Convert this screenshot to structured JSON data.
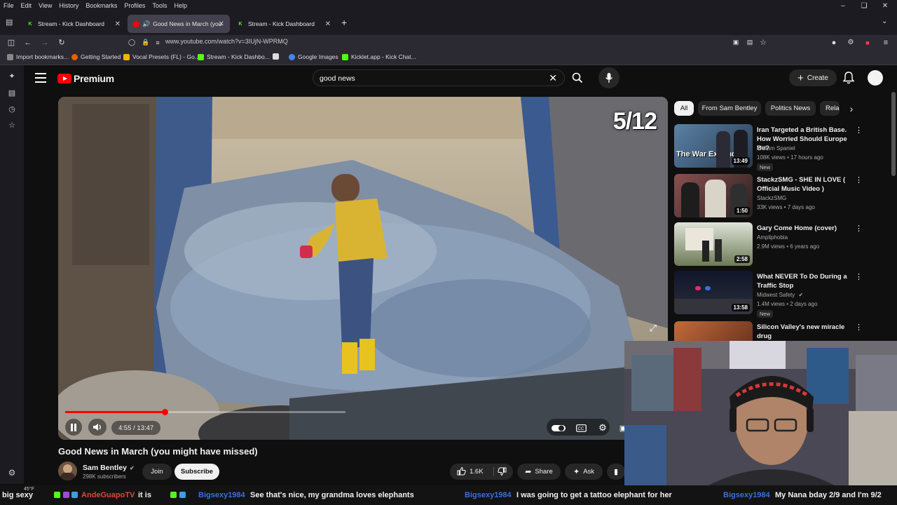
{
  "menubar": {
    "items": [
      "File",
      "Edit",
      "View",
      "History",
      "Bookmarks",
      "Profiles",
      "Tools",
      "Help"
    ]
  },
  "tabs": [
    {
      "label": "Stream - Kick Dashboard",
      "favicon": "kick-icon"
    },
    {
      "label": "Good News in March (you",
      "favicon": "youtube-icon",
      "audio": true
    },
    {
      "label": "Stream - Kick Dashboard",
      "favicon": "kick-icon"
    }
  ],
  "nav": {
    "url": "www.youtube.com/watch?v=3IUjN-WPRMQ"
  },
  "bookmarks": [
    {
      "label": "Import bookmarks...",
      "icon": "import-icon"
    },
    {
      "label": "Getting Started",
      "icon": "firefox-icon"
    },
    {
      "label": "Vocal Presets (FL) - Go...",
      "icon": "drive-icon"
    },
    {
      "label": "Stream - Kick Dashbo...",
      "icon": "kick-icon"
    },
    {
      "label": "",
      "icon": "s-icon"
    },
    {
      "label": "Google Images",
      "icon": "google-icon"
    },
    {
      "label": "Kicklet.app - Kick Chat...",
      "icon": "kicklet-icon"
    }
  ],
  "youtube": {
    "logo_text": "Premium",
    "search_value": "good news",
    "create_label": "Create"
  },
  "player": {
    "overlay_text": "5/12",
    "time_display": "4:55 / 13:47",
    "progress": 0.357
  },
  "video": {
    "title": "Good News in March (you might have missed)",
    "channel": "Sam Bentley",
    "subscribers": "298K subscribers",
    "join_label": "Join",
    "subscribe_label": "Subscribe",
    "likes": "1.6K",
    "share_label": "Share",
    "ask_label": "Ask"
  },
  "chips": [
    {
      "label": "All",
      "selected": true
    },
    {
      "label": "From Sam Bentley",
      "selected": false
    },
    {
      "label": "Politics News",
      "selected": false
    },
    {
      "label": "Rela",
      "selected": false
    }
  ],
  "recommendations": [
    {
      "title": "Iran Targeted a British Base. How Worried Should Europe Be?",
      "channel": "William Spaniel",
      "views": "108K views • 17 hours ago",
      "duration": "13:49",
      "badge": "New",
      "thumb_text": "The War Expands",
      "thumb_color": "#3f5f78"
    },
    {
      "title": "StackzSMG - SHE IN LOVE ( Official Music Video )",
      "channel": "StackzSMG",
      "views": "33K views • 7 days ago",
      "duration": "1:50",
      "badge": "",
      "thumb_text": "",
      "thumb_color": "#6d3a3a"
    },
    {
      "title": "Gary Come Home (cover)",
      "channel": "Ampliphobia",
      "views": "2.9M views • 6 years ago",
      "duration": "2:58",
      "badge": "",
      "thumb_text": "",
      "thumb_color": "#5d6a4a"
    },
    {
      "title": "What NEVER To Do During a Traffic Stop",
      "channel": "Midwest Safety",
      "views": "1.4M views • 2 days ago",
      "duration": "13:58",
      "badge": "New",
      "thumb_text": "",
      "thumb_color": "#1c2233"
    },
    {
      "title": "Silicon Valley's new miracle drug",
      "channel": "",
      "views": "",
      "duration": "",
      "badge": "",
      "thumb_text": "",
      "thumb_color": "#a04a2a"
    }
  ],
  "ticker": [
    {
      "text": "big sexy",
      "color": "#ffffff"
    },
    {
      "text": "AndeGuapoTV",
      "color": "#e0463a"
    },
    {
      "text": "it is",
      "color": "#ffffff"
    },
    {
      "text": "Bigsexy1984",
      "color": "#3a6ee0"
    },
    {
      "text": "See that's nice, my grandma loves elephants",
      "color": "#ffffff"
    },
    {
      "text": "Bigsexy1984",
      "color": "#3a6ee0"
    },
    {
      "text": "I was going to get a tattoo elephant for her",
      "color": "#ffffff"
    },
    {
      "text": "Bigsexy1984",
      "color": "#3a6ee0"
    },
    {
      "text": "My Nana bday 2/9 and I'm 9/2",
      "color": "#ffffff"
    }
  ],
  "taskbar": {
    "weather": "45°F"
  },
  "colors": {
    "accent_red": "#ff0000",
    "kick_green": "#53fc18",
    "bg": "#0f0f0f"
  }
}
